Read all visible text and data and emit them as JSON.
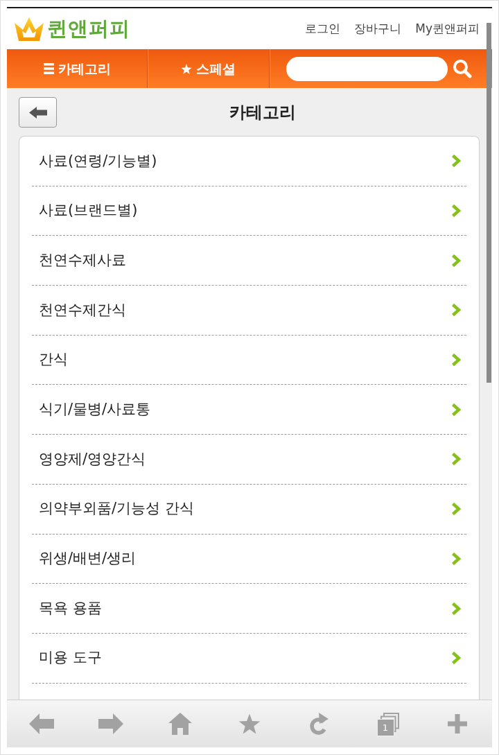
{
  "header": {
    "logo_text": "퀸앤퍼피",
    "links": [
      "로그인",
      "장바구니",
      "My퀸앤퍼피"
    ]
  },
  "nav": {
    "tabs": [
      {
        "kind": "menu",
        "label": "카테고리"
      },
      {
        "kind": "star",
        "label": "스페셜"
      }
    ]
  },
  "page": {
    "title": "카테고리"
  },
  "categories": [
    {
      "label": "사료(연령/기능별)"
    },
    {
      "label": "사료(브랜드별)"
    },
    {
      "label": "천연수제사료"
    },
    {
      "label": "천연수제간식"
    },
    {
      "label": "간식"
    },
    {
      "label": "식기/물병/사료통"
    },
    {
      "label": "영양제/영양간식"
    },
    {
      "label": "의약부외품/기능성 간식"
    },
    {
      "label": "위생/배변/생리"
    },
    {
      "label": "목욕 용품"
    },
    {
      "label": "미용 도구"
    }
  ],
  "toolbar": [
    {
      "kind": "back"
    },
    {
      "kind": "forward"
    },
    {
      "kind": "home"
    },
    {
      "kind": "bookmark"
    },
    {
      "kind": "reload"
    },
    {
      "kind": "tabs",
      "count": "1"
    },
    {
      "kind": "new_tab"
    }
  ]
}
